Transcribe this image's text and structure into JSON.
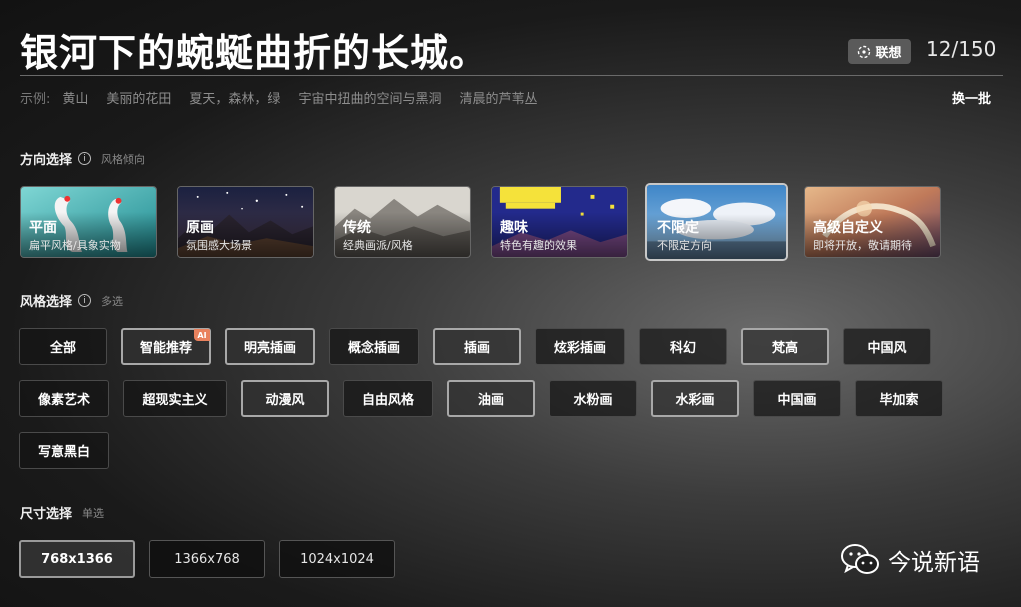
{
  "prompt": {
    "text": "银河下的蜿蜒曲折的长城。",
    "assoc_label": "联想",
    "char_count": "12/150"
  },
  "examples": {
    "label": "示例:",
    "items": [
      "黄山",
      "美丽的花田",
      "夏天，森林，绿",
      "宇宙中扭曲的空间与黑洞",
      "清晨的芦苇丛"
    ],
    "refresh_label": "换一批"
  },
  "direction": {
    "title": "方向选择",
    "hint": "风格倾向",
    "cards": [
      {
        "title": "平面",
        "subtitle": "扁平风格/具象实物",
        "selected": false
      },
      {
        "title": "原画",
        "subtitle": "氛围感大场景",
        "selected": false
      },
      {
        "title": "传统",
        "subtitle": "经典画派/风格",
        "selected": false
      },
      {
        "title": "趣味",
        "subtitle": "特色有趣的效果",
        "selected": false
      },
      {
        "title": "不限定",
        "subtitle": "不限定方向",
        "selected": true
      },
      {
        "title": "高级自定义",
        "subtitle": "即将开放，敬请期待",
        "selected": false
      }
    ]
  },
  "style": {
    "title": "风格选择",
    "hint": "多选",
    "ai_badge": "AI",
    "chips": [
      {
        "label": "全部",
        "active": false
      },
      {
        "label": "智能推荐",
        "active": true,
        "ai": true
      },
      {
        "label": "明亮插画",
        "active": true
      },
      {
        "label": "概念插画",
        "active": false
      },
      {
        "label": "插画",
        "active": true
      },
      {
        "label": "炫彩插画",
        "active": false
      },
      {
        "label": "科幻",
        "active": false
      },
      {
        "label": "梵高",
        "active": true
      },
      {
        "label": "中国风",
        "active": false
      },
      {
        "label": "像素艺术",
        "active": false
      },
      {
        "label": "超现实主义",
        "active": false
      },
      {
        "label": "动漫风",
        "active": true
      },
      {
        "label": "自由风格",
        "active": false
      },
      {
        "label": "油画",
        "active": true
      },
      {
        "label": "水粉画",
        "active": false
      },
      {
        "label": "水彩画",
        "active": true
      },
      {
        "label": "中国画",
        "active": false
      },
      {
        "label": "毕加索",
        "active": false
      },
      {
        "label": "写意黑白",
        "active": false
      }
    ]
  },
  "size": {
    "title": "尺寸选择",
    "hint": "单选",
    "options": [
      {
        "label": "768x1366",
        "active": true
      },
      {
        "label": "1366x768",
        "active": false
      },
      {
        "label": "1024x1024",
        "active": false
      }
    ]
  },
  "watermark": {
    "text": "今说新语"
  }
}
